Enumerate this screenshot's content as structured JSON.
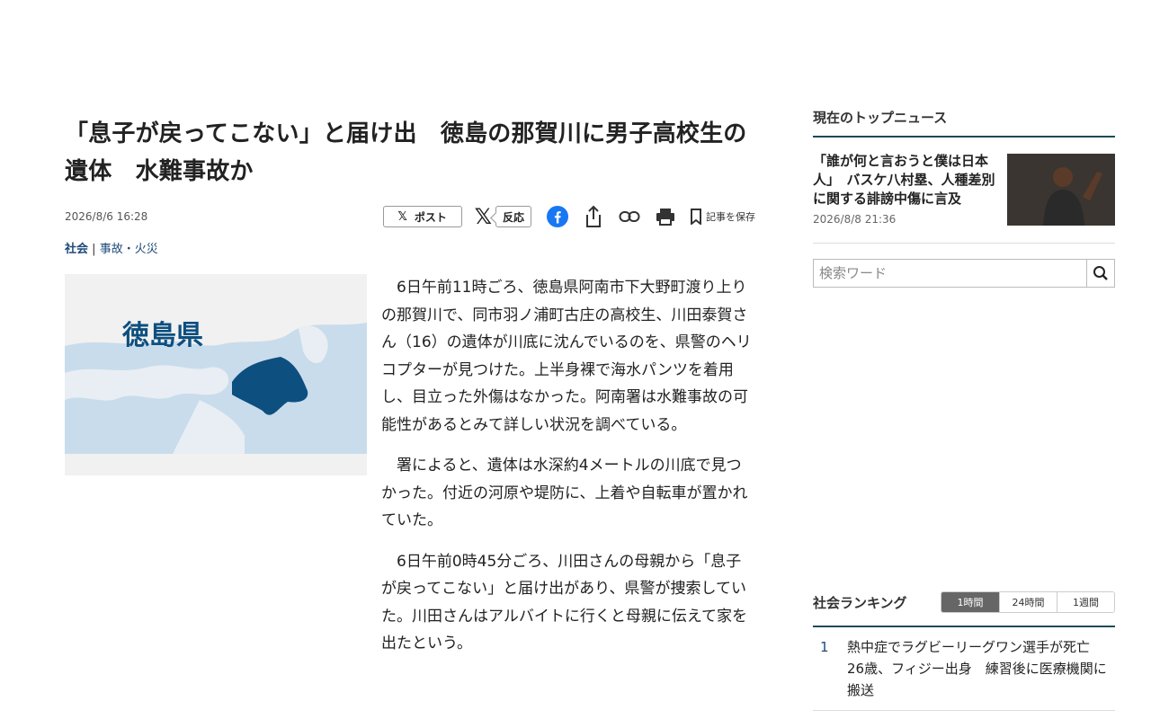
{
  "article": {
    "title": "「息子が戻ってこない」と届け出　徳島の那賀川に男子高校生の遺体　水難事故か",
    "date": "2026/8/6 16:28",
    "share": {
      "post_label": "ポスト",
      "react_label": "反応",
      "save_label": "記事を保存"
    },
    "category": {
      "main": "社会",
      "separator": "|",
      "sub": "事故・火災"
    },
    "figure": {
      "map_label": "徳島県"
    },
    "paragraphs": [
      "6日午前11時ごろ、徳島県阿南市下大野町渡り上りの那賀川で、同市羽ノ浦町古庄の高校生、川田泰賀さん（16）の遺体が川底に沈んでいるのを、県警のヘリコプターが見つけた。上半身裸で海水パンツを着用し、目立った外傷はなかった。阿南署は水難事故の可能性があるとみて詳しい状況を調べている。",
      "署によると、遺体は水深約4メートルの川底で見つかった。付近の河原や堤防に、上着や自転車が置かれていた。",
      "6日午前0時45分ごろ、川田さんの母親から「息子が戻ってこない」と届け出があり、県警が捜索していた。川田さんはアルバイトに行くと母親に伝えて家を出たという。"
    ]
  },
  "sidebar": {
    "top_news": {
      "heading": "現在のトップニュース",
      "headline": "「誰が何と言おうと僕は日本人」　バスケ八村塁、人種差別に関する誹謗中傷に言及",
      "time": "2026/8/8 21:36"
    },
    "search": {
      "placeholder": "検索ワード"
    },
    "ranking": {
      "heading": "社会ランキング",
      "tabs": [
        "1時間",
        "24時間",
        "1週間"
      ],
      "items": [
        {
          "rank": "1",
          "text": "熱中症でラグビーリーグワン選手が死亡　26歳、フィジー出身　練習後に医療機関に搬送"
        }
      ]
    }
  },
  "colors": {
    "accent": "#1e4a7a",
    "map_highlight": "#0d4f7f",
    "map_land": "#c9dcec"
  }
}
